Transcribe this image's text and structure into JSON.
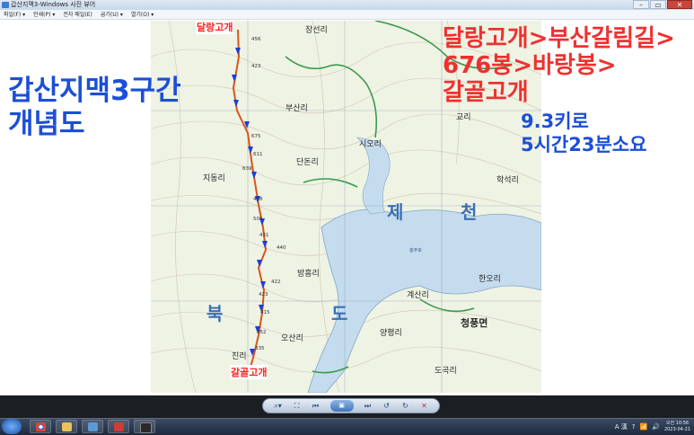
{
  "window": {
    "title": "갑산지맥3-Windows 사진 뷰어",
    "buttons": {
      "minimize": "–",
      "maximize": "▭",
      "close": "✕"
    }
  },
  "menu": {
    "items": [
      "파일(F)  ▾",
      "인쇄(P)  ▾",
      "전자 메일(E)",
      "굽기(U)  ▾",
      "열기(O)  ▾"
    ]
  },
  "overlay": {
    "title_line1": "갑산지맥3구간",
    "title_line2": "개념도",
    "route_line1": "달랑고개>부산갈림길>",
    "route_line2": "676봉>바랑봉>",
    "route_line3": "갈골고개",
    "distance": "9.3키로",
    "duration": "5시간23분소요"
  },
  "map": {
    "start_label": "달랑고개",
    "end_label": "갈골고개",
    "villages": [
      "장선리",
      "부산리",
      "시오리",
      "단돈리",
      "지동리",
      "방흥리",
      "오산리",
      "계산리",
      "청풍면",
      "도곡리",
      "양평리",
      "한오리",
      "교리",
      "학석리",
      "진리"
    ],
    "region_chars": [
      "제",
      "천",
      "북",
      "도"
    ],
    "lake_label": "충주호",
    "peaks": [
      "456",
      "423",
      "675",
      "611",
      "639",
      "458",
      "505",
      "431",
      "440",
      "422",
      "423",
      "415",
      "352",
      "335"
    ],
    "colors": {
      "lake": "#c5dcee",
      "forest": "#eef3e4",
      "road": "#3a9b4a",
      "route": "#d9541b",
      "arrow": "#1c3fd8"
    }
  },
  "viewer": {
    "buttons": {
      "zoom": "⌕▾",
      "fit": "⛶",
      "prev": "⏮",
      "slideshow": "▣",
      "next": "⏭",
      "rotate_ccw": "↺",
      "rotate_cw": "↻",
      "delete": "✕"
    }
  },
  "taskbar": {
    "tray": {
      "language": "A 漢",
      "help": "?",
      "volume": "🔊",
      "network": "📶"
    },
    "time": "오전 10:56",
    "date": "2023-04-21"
  }
}
